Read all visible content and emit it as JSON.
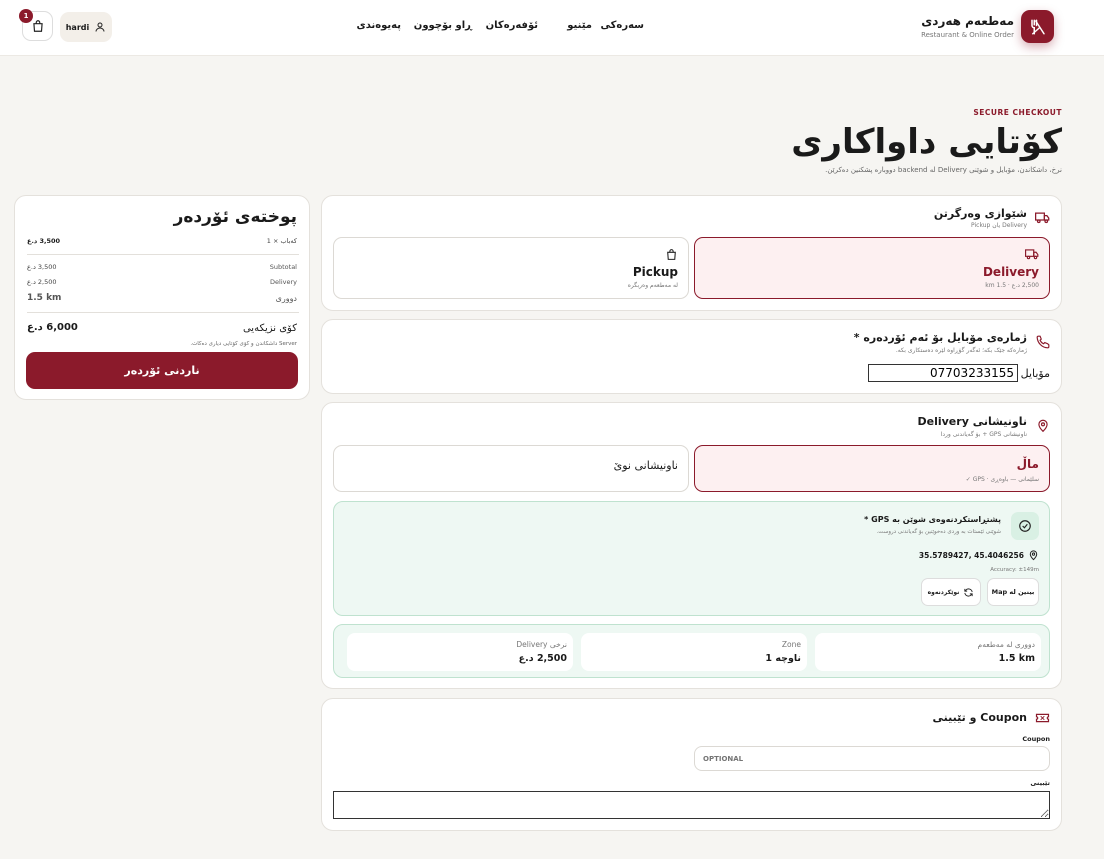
{
  "header": {
    "brand_name": "مەطعەم هەردی",
    "brand_sub": "Restaurant & Online Order",
    "nav": [
      "سەرەکی",
      "مێنیو",
      "ئۆفەرەکان",
      "ڕاو بۆچوون",
      "پەیوەندی"
    ],
    "user_name": "hardi",
    "cart_count": "1"
  },
  "page": {
    "eyebrow": "SECURE CHECKOUT",
    "title": "کۆتایی داواکاری",
    "subtitle": "نرخ، داشکاندن، مۆبایل و شوێنی Delivery لە backend دووبارە پشکنین دەکرێن."
  },
  "delivery_method": {
    "title": "شێوازی وەرگرتن",
    "sub": "Delivery یان Pickup",
    "delivery": {
      "label": "Delivery",
      "meta": "2,500 د.ع · 1.5 km"
    },
    "pickup": {
      "label": "Pickup",
      "meta": "لە مەطعەم وەربگرە"
    }
  },
  "phone": {
    "title": "ژمارەی مۆبایل بۆ ئەم ئۆردەرە *",
    "sub": "ژمارەکە جێک بکە؛ ئەگەر گۆڕاوە لێرە دەستکاری بکە.",
    "label": "مۆبایل",
    "value": "07703233155"
  },
  "address": {
    "title": "ناونیشانی Delivery",
    "sub": "ناونیشانی GPS + بۆ گەیاندنی وردا",
    "home": {
      "label": "ماڵ",
      "meta": "سلێمانی — باوەڕی · GPS ✓"
    },
    "new_label": "ناونیشانی نوێ",
    "gps": {
      "title": "پشتڕاستکردنەوەی شوێن بە GPS *",
      "sub": "شوێنی ئێستات بە وردی دەخوێنین بۆ گەیاندنی دروست.",
      "coords": "35.5789427, 45.4046256",
      "accuracy": "Accuracy: ±149m",
      "map_btn": "بینین لە Map",
      "refresh_btn": "نوێکردنەوە"
    },
    "stats": [
      {
        "label": "دووری لە مەطعەم",
        "value": "1.5 km"
      },
      {
        "label": "Zone",
        "value": "ناوچە 1"
      },
      {
        "label": "نرخی Delivery",
        "value": "2,500 د.ع"
      }
    ]
  },
  "coupon": {
    "title": "Coupon و تێبینی",
    "coupon_label": "Coupon",
    "coupon_placeholder": "OPTIONAL",
    "note_label": "تێبینی"
  },
  "summary": {
    "title": "پوختەی ئۆردەر",
    "item_name": "کەباب × 1",
    "item_price": "3,500 د.ع",
    "subtotal_label": "Subtotal",
    "subtotal": "3,500 د.ع",
    "delivery_label": "Delivery",
    "delivery": "2,500 د.ع",
    "distance_label": "دووری",
    "distance": "1.5 km",
    "total_label": "کۆی نزیکەیی",
    "total": "6,000 د.ع",
    "note": "Server داشکاندن و کۆی کۆتایی دیاری دەکات.",
    "submit": "ناردنی ئۆردەر"
  },
  "colors": {
    "accent": "#8b1a2b",
    "background": "#f6f5f2"
  }
}
